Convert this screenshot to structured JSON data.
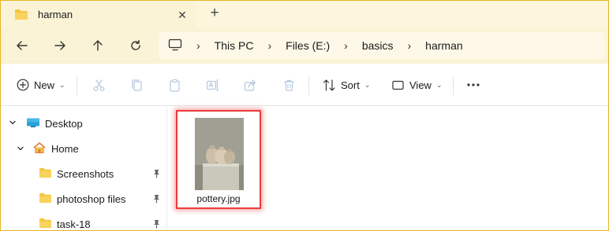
{
  "tab": {
    "title": "harman",
    "close_glyph": "✕",
    "new_tab_glyph": "+"
  },
  "navigation": {
    "back": "arrow-left-icon",
    "forward": "arrow-right-icon",
    "up": "arrow-up-icon",
    "refresh": "refresh-icon"
  },
  "breadcrumb": [
    "This PC",
    "Files (E:)",
    "basics",
    "harman"
  ],
  "command_bar": {
    "new_label": "New",
    "sort_label": "Sort",
    "view_label": "View",
    "more_glyph": "..."
  },
  "sidebar": {
    "items": [
      {
        "label": "Desktop",
        "expanded": true,
        "pinned": false
      },
      {
        "label": "Home",
        "expanded": true,
        "pinned": false
      },
      {
        "label": "Screenshots",
        "pinned": true
      },
      {
        "label": "photoshop files",
        "pinned": true
      },
      {
        "label": "task-18",
        "pinned": true
      }
    ]
  },
  "files": [
    {
      "name": "pottery.jpg",
      "selected": true
    }
  ],
  "colors": {
    "accent_border": "#e6b422",
    "selection_outline": "#ec3b3b",
    "folder_yellow": "#f4c542"
  }
}
